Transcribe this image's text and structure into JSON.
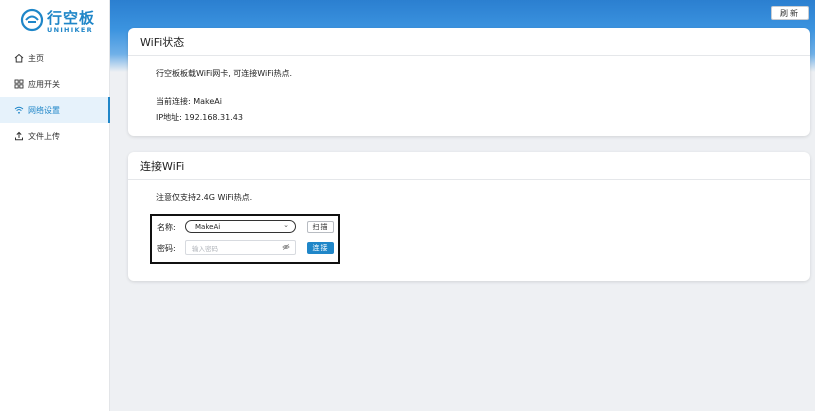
{
  "logo": {
    "cn": "行空板",
    "en": "UNIHIKER"
  },
  "sidebar": {
    "items": [
      {
        "label": "主页",
        "icon": "home-icon"
      },
      {
        "label": "应用开关",
        "icon": "apps-grid-icon"
      },
      {
        "label": "网络设置",
        "icon": "wifi-icon",
        "active": true
      },
      {
        "label": "文件上传",
        "icon": "upload-icon"
      }
    ]
  },
  "header": {
    "refresh_label": "刷新"
  },
  "wifi_status": {
    "title": "WiFi状态",
    "desc": "行空板板载WiFi网卡, 可连接WiFi热点.",
    "current": "当前连接: MakeAi",
    "ip": "IP地址: 192.168.31.43"
  },
  "connect_wifi": {
    "title": "连接WiFi",
    "note": "注意仅支持2.4G WiFi热点.",
    "name_label": "名称:",
    "name_value": "MakeAi",
    "scan_label": "扫描",
    "pwd_label": "密码:",
    "pwd_placeholder": "输入密码",
    "connect_label": "连接"
  },
  "colors": {
    "accent": "#1f86c8",
    "banner": "#2b7fd0"
  }
}
